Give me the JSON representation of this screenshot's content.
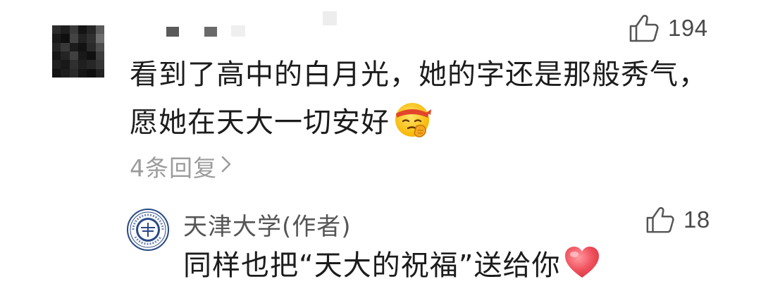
{
  "comment": {
    "like_count": "194",
    "text": "看到了高中的白月光，她的字还是那般秀气，愿她在天大一切安好",
    "emoji": "saluting-face-with-headband-emoji",
    "reply_link_label": "4条回复"
  },
  "author_reply": {
    "author_name": "天津大学(作者)",
    "like_count": "18",
    "text": "同样也把“天大的祝福”送给你",
    "emoji": "red-heart-emoji"
  },
  "icons": {
    "like": "thumbs-up-outline-icon",
    "reply_chevron": "chevron-right-icon",
    "avatar": "pixelated-avatar",
    "author_avatar": "tianjin-university-seal-logo"
  },
  "colors": {
    "text": "#1c1c1c",
    "secondary_text": "#9c9c9c",
    "like_icon": "#555555",
    "heart": "#f0505c"
  }
}
